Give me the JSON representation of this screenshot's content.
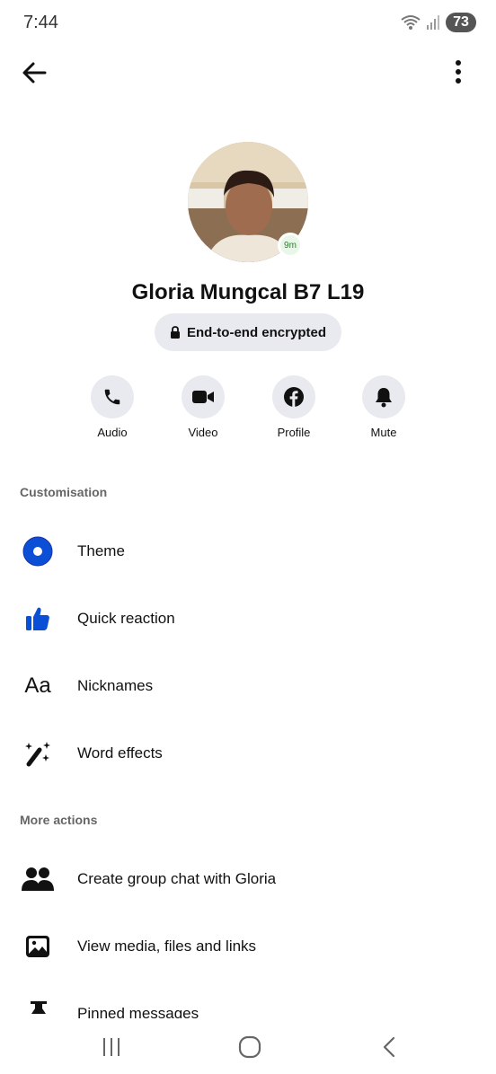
{
  "status_bar": {
    "time": "7:44",
    "battery": "73"
  },
  "contact": {
    "name": "Gloria Mungcal B7 L19",
    "active_ago": "9m",
    "encryption": "End-to-end encrypted"
  },
  "actions": [
    {
      "label": "Audio",
      "icon": "phone-icon"
    },
    {
      "label": "Video",
      "icon": "video-camera-icon"
    },
    {
      "label": "Profile",
      "icon": "facebook-icon"
    },
    {
      "label": "Mute",
      "icon": "bell-icon"
    }
  ],
  "customisation": {
    "header": "Customisation",
    "items": [
      {
        "label": "Theme",
        "icon": "theme-icon"
      },
      {
        "label": "Quick reaction",
        "icon": "thumbs-up-icon"
      },
      {
        "label": "Nicknames",
        "icon": "text-aa-icon",
        "glyph": "Aa"
      },
      {
        "label": "Word effects",
        "icon": "magic-wand-icon"
      }
    ]
  },
  "more_actions": {
    "header": "More actions",
    "items": [
      {
        "label": "Create group chat with Gloria",
        "icon": "people-icon"
      },
      {
        "label": "View media, files and links",
        "icon": "image-icon"
      },
      {
        "label": "Pinned messages",
        "icon": "pin-icon"
      }
    ]
  },
  "colors": {
    "accent_blue": "#0a4fd6",
    "pill_bg": "#e9eaef",
    "section_grey": "#666666"
  }
}
